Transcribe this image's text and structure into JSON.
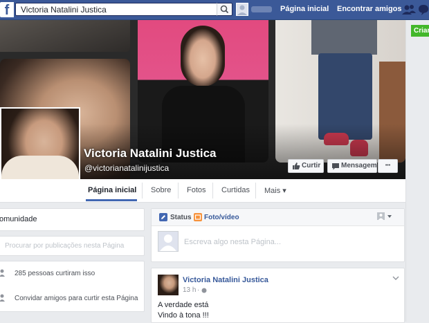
{
  "topbar": {
    "search_value": "Victoria Natalini Justica",
    "nav_home": "Página inicial",
    "nav_find_friends": "Encontrar amigos"
  },
  "right_rail": {
    "create_label": "Criar"
  },
  "page": {
    "name": "Victoria Natalini Justica",
    "handle": "@victorianatalinijustica",
    "like_label": "Curtir",
    "message_label": "Mensagem",
    "more_dots": "•••"
  },
  "tabs": [
    {
      "label": "Página inicial",
      "active": true
    },
    {
      "label": "Sobre"
    },
    {
      "label": "Fotos"
    },
    {
      "label": "Curtidas"
    },
    {
      "label": "Mais ▾"
    }
  ],
  "left_column": {
    "category": "omunidade",
    "search_placeholder": "Procurar por publicações nesta Página",
    "likes_text": "285 pessoas curtiram isso",
    "invite_text": "Convidar amigos para curtir esta Página"
  },
  "composer": {
    "status_label": "Status",
    "photo_label": "Foto/vídeo",
    "placeholder": "Escreva algo nesta Página..."
  },
  "post": {
    "author": "Victoria Natalini Justica",
    "time": "13 h",
    "sep": "·",
    "line1": "A verdade está",
    "line2": "Vindo à tona !!!"
  },
  "colors": {
    "brand": "#3b5998",
    "link": "#365899",
    "create": "#42b72a"
  }
}
